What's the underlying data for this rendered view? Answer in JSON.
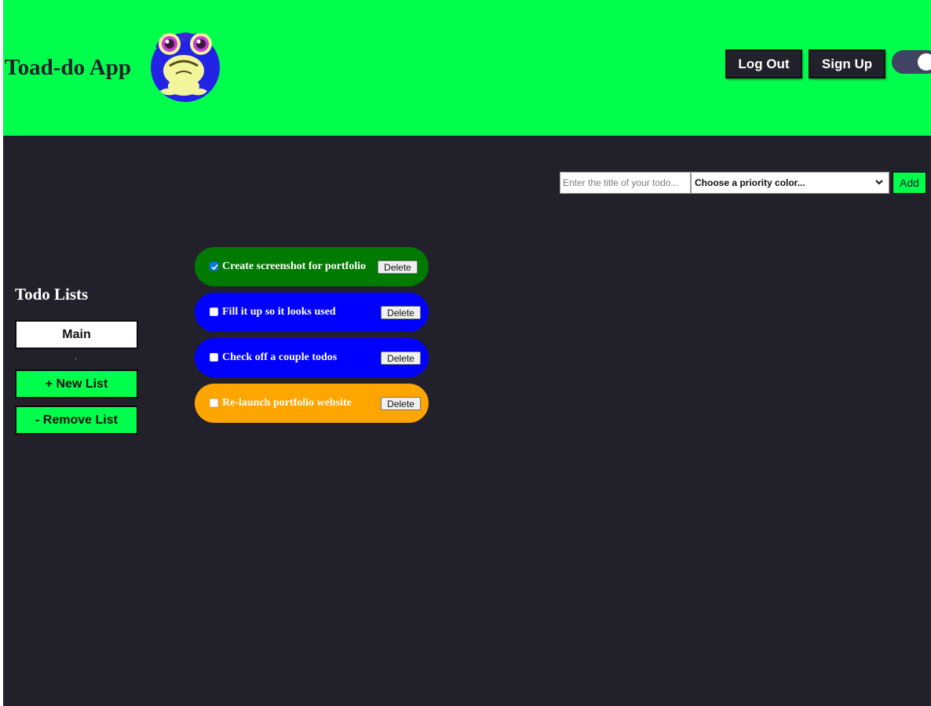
{
  "header": {
    "title": "Toad-do App",
    "logo_icon": "frog-logo-icon",
    "logout_label": "Log Out",
    "signup_label": "Sign Up",
    "theme_toggle_on": true,
    "accent_color": "#00ff4c"
  },
  "add_todo": {
    "title_placeholder": "Enter the title of your todo...",
    "title_value": "",
    "priority_selected": "Choose a priority color...",
    "add_label": "Add"
  },
  "sidebar": {
    "title": "Todo Lists",
    "lists": [
      {
        "label": "Main",
        "selected": true
      }
    ],
    "separator": ".",
    "new_list_label": "+ New List",
    "remove_list_label": "- Remove List"
  },
  "todos": [
    {
      "title": "Create screenshot for portfolio",
      "checked": true,
      "color": "#007a00",
      "delete_label": "Delete"
    },
    {
      "title": "Fill it up so it looks used",
      "checked": false,
      "color": "#0000ff",
      "delete_label": "Delete"
    },
    {
      "title": "Check off a couple todos",
      "checked": false,
      "color": "#0000ff",
      "delete_label": "Delete"
    },
    {
      "title": "Re-launch portfolio website",
      "checked": false,
      "color": "#ffa500",
      "delete_label": "Delete"
    }
  ],
  "colors": {
    "background": "#22212b",
    "header_bg": "#00ff4c",
    "button_dark": "#22212b",
    "toggle_track": "#414363"
  }
}
